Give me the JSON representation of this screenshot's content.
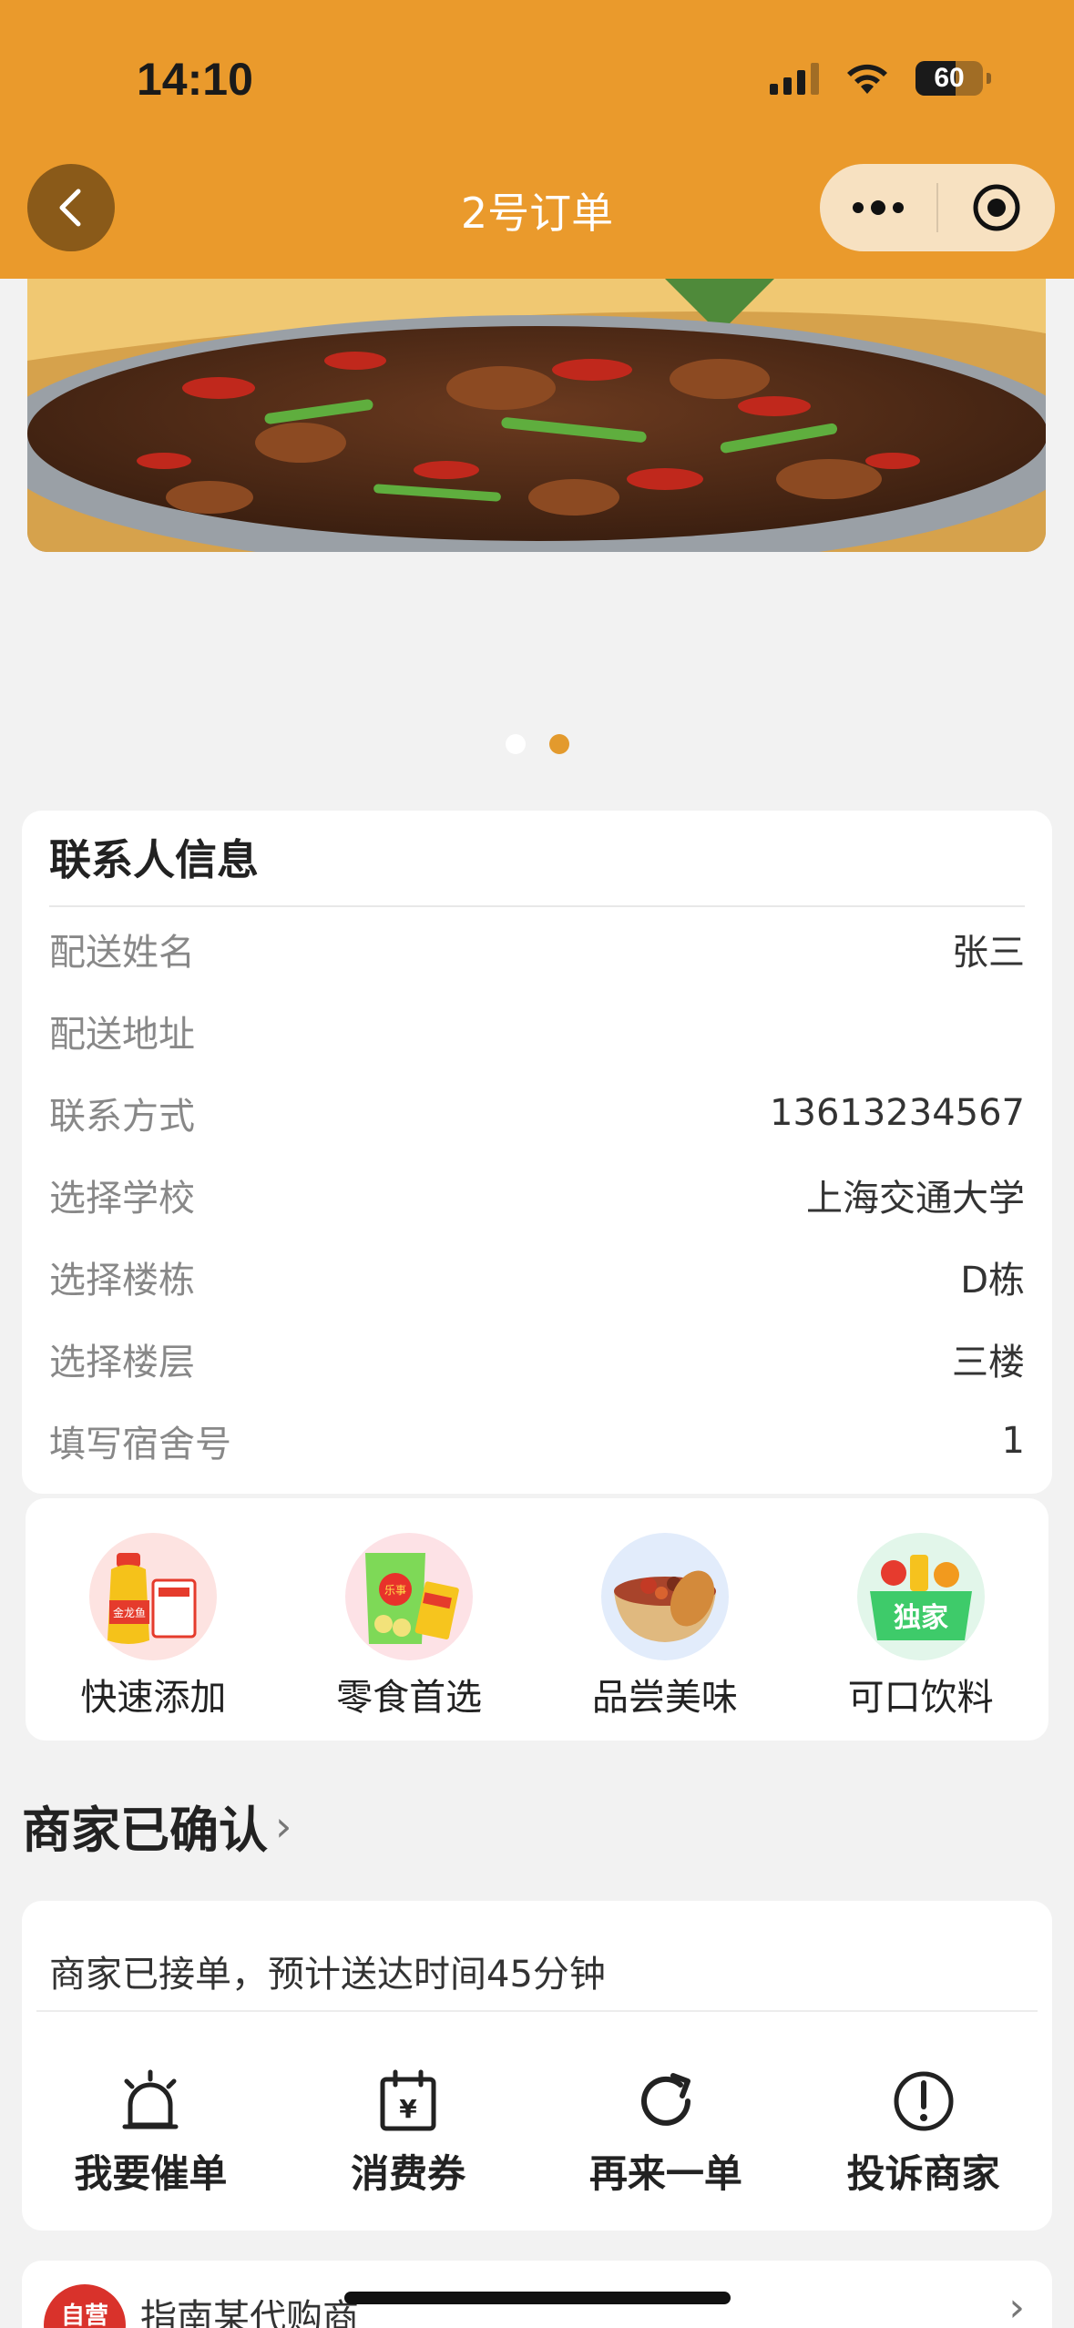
{
  "status_bar": {
    "time": "14:10",
    "battery": "60",
    "battery_level_pct": 60
  },
  "nav": {
    "title": "2号订单"
  },
  "carousel": {
    "slide_count": 2,
    "active_index": 1
  },
  "contact": {
    "title": "联系人信息",
    "rows": [
      {
        "label": "配送姓名",
        "value": "张三"
      },
      {
        "label": "配送地址",
        "value": ""
      },
      {
        "label": "联系方式",
        "value": "13613234567"
      },
      {
        "label": "选择学校",
        "value": "上海交通大学"
      },
      {
        "label": "选择楼栋",
        "value": "D栋"
      },
      {
        "label": "选择楼层",
        "value": "三楼"
      },
      {
        "label": "填写宿舍号",
        "value": "1"
      }
    ]
  },
  "categories": [
    {
      "label": "快速添加",
      "icon": "oil-bottle-icon",
      "logo_text": "金龙鱼"
    },
    {
      "label": "零食首选",
      "icon": "chips-bag-icon",
      "logo_text": "乐事"
    },
    {
      "label": "品尝美味",
      "icon": "food-bowl-icon"
    },
    {
      "label": "可口饮料",
      "icon": "drinks-basket-icon",
      "badge": "独家"
    }
  ],
  "order_status": {
    "title": "商家已确认",
    "message": "商家已接单，预计送达时间45分钟",
    "actions": [
      {
        "label": "我要催单",
        "icon": "alarm-icon"
      },
      {
        "label": "消费券",
        "icon": "coupon-calendar-icon"
      },
      {
        "label": "再来一单",
        "icon": "refresh-icon"
      },
      {
        "label": "投诉商家",
        "icon": "exclamation-icon"
      }
    ]
  },
  "promo": {
    "text": "指南某代购商",
    "logo_text": "自营"
  },
  "colors": {
    "header": "#ea9a2c",
    "accent": "#e39a2d",
    "back_button": "#8a5a19",
    "capsule": "#f7e1c1"
  }
}
